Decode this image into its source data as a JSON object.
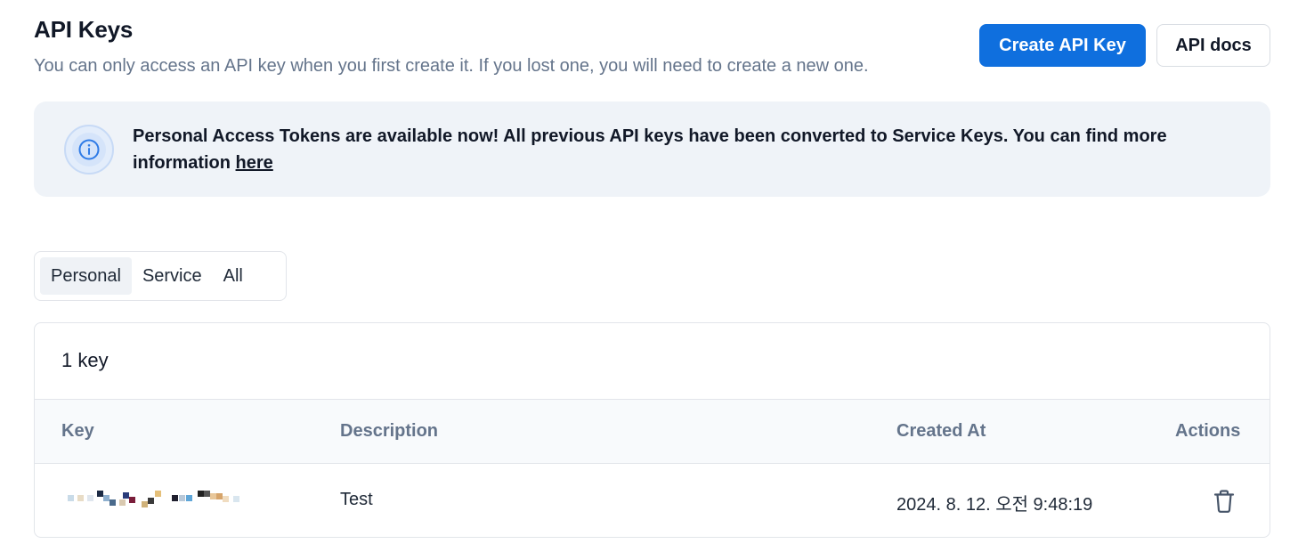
{
  "header": {
    "title": "API Keys",
    "subtitle": "You can only access an API key when you first create it. If you lost one, you will need to create a new one."
  },
  "actions": {
    "create_label": "Create API Key",
    "docs_label": "API docs"
  },
  "banner": {
    "text": "Personal Access Tokens are available now! All previous API keys have been converted to Service Keys. You can find more information ",
    "link_label": "here",
    "icon": "info-icon"
  },
  "tabs": [
    {
      "label": "Personal",
      "active": true
    },
    {
      "label": "Service",
      "active": false
    },
    {
      "label": "All",
      "active": false
    }
  ],
  "keys": {
    "count_label": "1 key",
    "columns": [
      "Key",
      "Description",
      "Created At",
      "Actions"
    ],
    "rows": [
      {
        "key": "masked",
        "description": "Test",
        "created_at": "2024. 8. 12. 오전 9:48:19",
        "action_icon": "trash-icon"
      }
    ]
  },
  "colors": {
    "primary": "#0f6fde",
    "banner_bg": "#eff3f8",
    "muted_text": "#64748b"
  }
}
